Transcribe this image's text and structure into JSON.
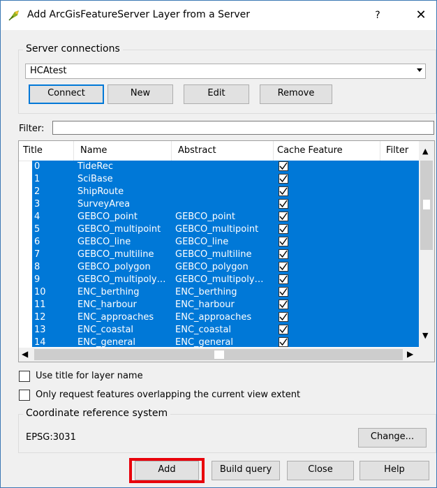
{
  "window": {
    "title": "Add ArcGisFeatureServer Layer from a Server",
    "help_label": "?",
    "close_label": "✕"
  },
  "server": {
    "group_title": "Server connections",
    "selected": "HCAtest",
    "buttons": {
      "connect": "Connect",
      "new": "New",
      "edit": "Edit",
      "remove": "Remove"
    }
  },
  "filter": {
    "label": "Filter:",
    "value": ""
  },
  "table": {
    "columns": [
      "Title",
      "Name",
      "Abstract",
      "Cache Feature",
      "Filter"
    ],
    "rows": [
      {
        "title": "0",
        "name": "TideRec",
        "abstract": "",
        "cache": true
      },
      {
        "title": "1",
        "name": "SciBase",
        "abstract": "",
        "cache": true
      },
      {
        "title": "2",
        "name": "ShipRoute",
        "abstract": "",
        "cache": true
      },
      {
        "title": "3",
        "name": "SurveyArea",
        "abstract": "",
        "cache": true
      },
      {
        "title": "4",
        "name": "GEBCO_point",
        "abstract": "GEBCO_point",
        "cache": true
      },
      {
        "title": "5",
        "name": "GEBCO_multipoint",
        "abstract": "GEBCO_multipoint",
        "cache": true
      },
      {
        "title": "6",
        "name": "GEBCO_line",
        "abstract": "GEBCO_line",
        "cache": true
      },
      {
        "title": "7",
        "name": "GEBCO_multiline",
        "abstract": "GEBCO_multiline",
        "cache": true
      },
      {
        "title": "8",
        "name": "GEBCO_polygon",
        "abstract": "GEBCO_polygon",
        "cache": true
      },
      {
        "title": "9",
        "name": "GEBCO_multipoly…",
        "abstract": "GEBCO_multipoly…",
        "cache": true
      },
      {
        "title": "10",
        "name": "ENC_berthing",
        "abstract": "ENC_berthing",
        "cache": true
      },
      {
        "title": "11",
        "name": "ENC_harbour",
        "abstract": "ENC_harbour",
        "cache": true
      },
      {
        "title": "12",
        "name": "ENC_approaches",
        "abstract": "ENC_approaches",
        "cache": true
      },
      {
        "title": "13",
        "name": "ENC_coastal",
        "abstract": "ENC_coastal",
        "cache": true
      },
      {
        "title": "14",
        "name": "ENC_general",
        "abstract": "ENC_general",
        "cache": true
      }
    ]
  },
  "options": {
    "use_title": "Use title for layer name",
    "only_request": "Only request features overlapping the current view extent"
  },
  "crs": {
    "group_title": "Coordinate reference system",
    "value": "EPSG:3031",
    "change_label": "Change..."
  },
  "footer": {
    "add": "Add",
    "build_query": "Build query",
    "close": "Close",
    "help": "Help"
  },
  "colors": {
    "selection": "#0078d7",
    "highlight": "#e8000b"
  }
}
